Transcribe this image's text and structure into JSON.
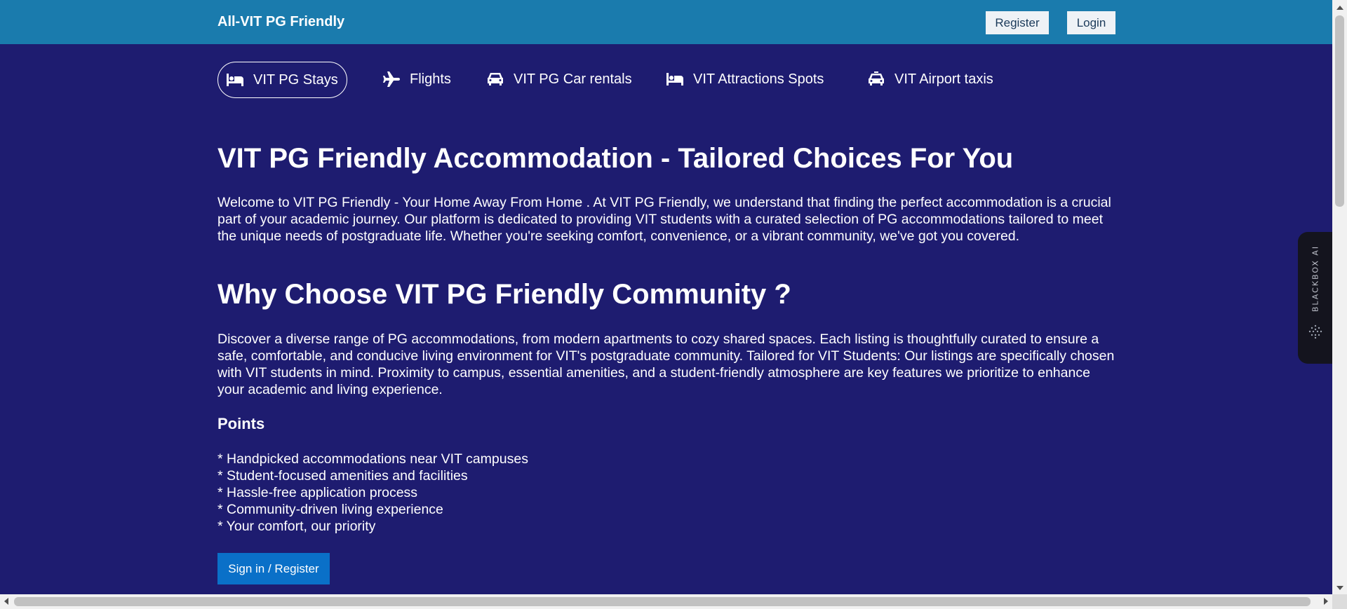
{
  "header": {
    "brand": "All-VIT PG Friendly",
    "register_label": "Register",
    "login_label": "Login"
  },
  "nav": {
    "items": [
      {
        "label": "VIT PG Stays",
        "icon": "bed-icon",
        "active": true
      },
      {
        "label": "Flights",
        "icon": "plane-icon",
        "active": false
      },
      {
        "label": "VIT PG Car rentals",
        "icon": "car-icon",
        "active": false
      },
      {
        "label": "VIT Attractions Spots",
        "icon": "bed-icon",
        "active": false
      },
      {
        "label": "VIT Airport taxis",
        "icon": "taxi-icon",
        "active": false
      }
    ]
  },
  "main": {
    "title": "VIT PG Friendly Accommodation - Tailored Choices For You",
    "intro": "Welcome to VIT PG Friendly - Your Home Away From Home . At VIT PG Friendly, we understand that finding the perfect accommodation is a crucial part of your academic journey. Our platform is dedicated to providing VIT students with a curated selection of PG accommodations tailored to meet the unique needs of postgraduate life. Whether you're seeking comfort, convenience, or a vibrant community, we've got you covered.",
    "why_title": "Why Choose VIT PG Friendly Community ?",
    "why_text": "Discover a diverse range of PG accommodations, from modern apartments to cozy shared spaces. Each listing is thoughtfully curated to ensure a safe, comfortable, and conducive living environment for VIT's postgraduate community. Tailored for VIT Students: Our listings are specifically chosen with VIT students in mind. Proximity to campus, essential amenities, and a student-friendly atmosphere are key features we prioritize to enhance your academic and living experience.",
    "points_title": "Points",
    "points": [
      "* Handpicked accommodations near VIT campuses",
      "* Student-focused amenities and facilities",
      "* Hassle-free application process",
      "* Community-driven living experience",
      "* Your comfort, our priority"
    ],
    "cta_label": "Sign in / Register"
  },
  "widget": {
    "label": "BLACKBOX AI",
    "icon": "blackbox-logo-icon"
  },
  "colors": {
    "header_bg": "#1a7bad",
    "page_bg": "#1e1c70",
    "cta_bg": "#0a70c8"
  }
}
